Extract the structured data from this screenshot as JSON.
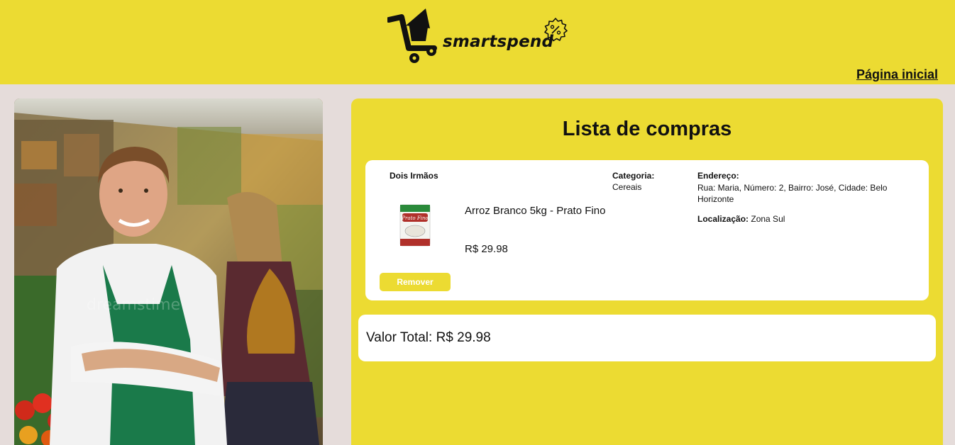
{
  "header": {
    "brand": "smartspend",
    "nav_home": "Página inicial"
  },
  "photo": {
    "watermark": "dreamstime"
  },
  "cart": {
    "title": "Lista de compras",
    "items": [
      {
        "store": "Dois Irmãos",
        "product_name": "Arroz Branco 5kg - Prato Fino",
        "price": "R$ 29.98",
        "remove_label": "Remover",
        "category_label": "Categoria:",
        "category_value": "Cereais",
        "address_label": "Endereço:",
        "address_value": "Rua: Maria, Número: 2, Bairro: José, Cidade: Belo Horizonte",
        "location_label": "Localização:",
        "location_value": "Zona Sul",
        "package_brand": "Prato Fino"
      }
    ],
    "total": "Valor Total: R$ 29.98"
  },
  "colors": {
    "accent": "#ecdb32",
    "background": "#e5dcda",
    "card": "#ffffff",
    "text": "#111111"
  },
  "icons": [
    "shopping-cart-logo-icon",
    "percent-badge-icon"
  ]
}
